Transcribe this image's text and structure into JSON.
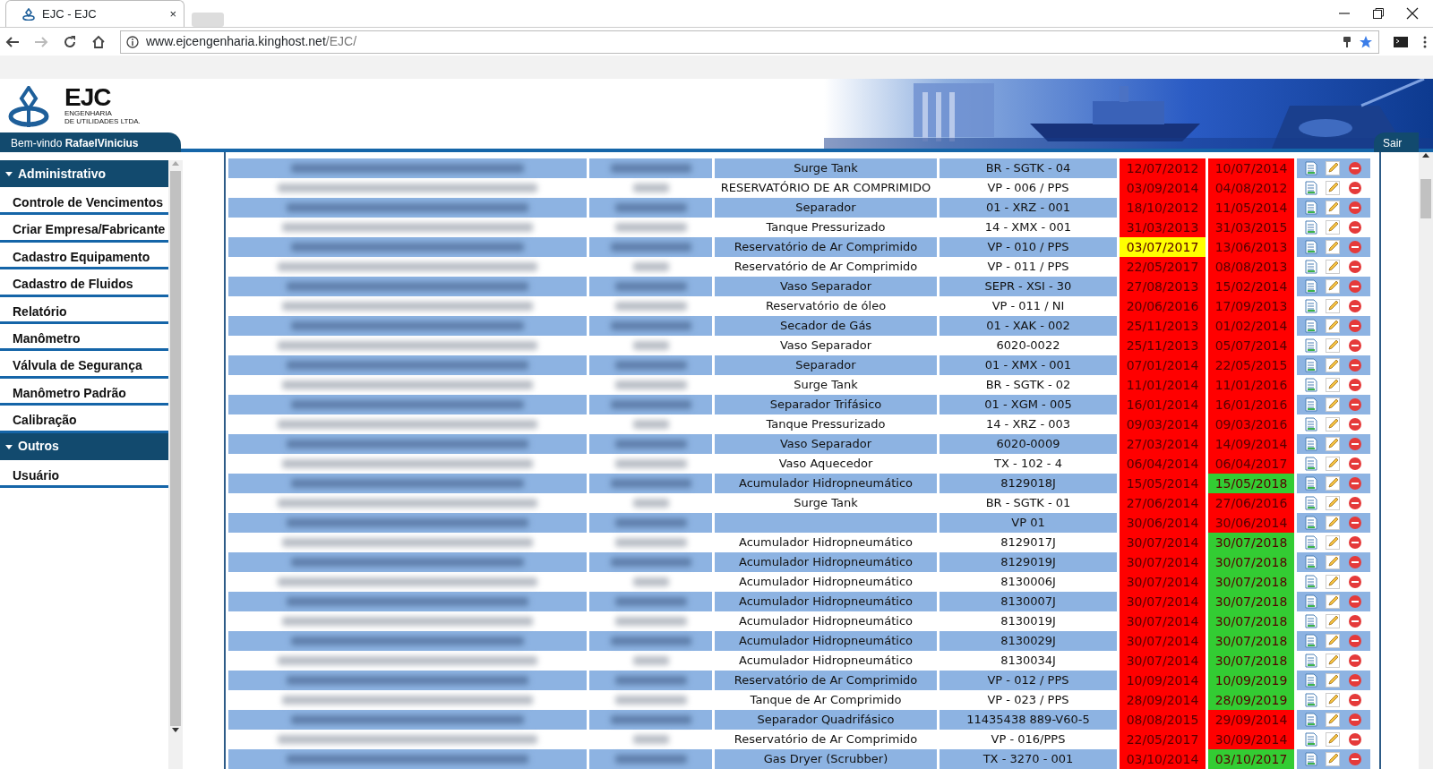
{
  "browser": {
    "tab_title": "EJC - EJC",
    "tab_close": "×",
    "url_host": "www.ejcengenharia.kinghost.net",
    "url_path": "/EJC/"
  },
  "header": {
    "logo_text": "EJC",
    "logo_subtitle_1": "ENGENHARIA",
    "logo_subtitle_2": "DE UTILIDADES LTDA.",
    "welcome": "Bem-vindo **RafaelVinicius**",
    "logout": "Sair"
  },
  "sidebar": {
    "sections": [
      {
        "label": "Administrativo",
        "expanded": true,
        "items": [
          "Controle de Vencimentos",
          "Criar Empresa/Fabricante",
          "Cadastro Equipamento",
          "Cadastro de Fluidos",
          "Relatório",
          "Manômetro",
          "Válvula de Segurança",
          "Manômetro Padrão",
          "Calibração"
        ]
      },
      {
        "label": "Outros",
        "expanded": true,
        "items": [
          "Usuário"
        ]
      }
    ]
  },
  "table": {
    "rows": [
      {
        "equipment": "Surge Tank",
        "tag": "BR - SGTK - 04",
        "date_1": {
          "text": "12/07/2012",
          "color": "#ff0000"
        },
        "date_2": {
          "text": "10/07/2014",
          "color": "#ff0000"
        }
      },
      {
        "equipment": "RESERVATÓRIO DE AR COMPRIMIDO",
        "tag": "VP - 006 / PPS",
        "date_1": {
          "text": "03/09/2014",
          "color": "#ff0000"
        },
        "date_2": {
          "text": "04/08/2012",
          "color": "#ff0000"
        }
      },
      {
        "equipment": "Separador",
        "tag": "01 - XRZ - 001",
        "date_1": {
          "text": "18/10/2012",
          "color": "#ff0000"
        },
        "date_2": {
          "text": "11/05/2014",
          "color": "#ff0000"
        }
      },
      {
        "equipment": "Tanque Pressurizado",
        "tag": "14 - XMX - 001",
        "date_1": {
          "text": "31/03/2013",
          "color": "#ff0000"
        },
        "date_2": {
          "text": "31/03/2015",
          "color": "#ff0000"
        }
      },
      {
        "equipment": "Reservatório de Ar Comprimido",
        "tag": "VP - 010 / PPS",
        "date_1": {
          "text": "03/07/2017",
          "color": "#ffff00"
        },
        "date_2": {
          "text": "13/06/2013",
          "color": "#ff0000"
        }
      },
      {
        "equipment": "Reservatório de Ar Comprimido",
        "tag": "VP - 011 / PPS",
        "date_1": {
          "text": "22/05/2017",
          "color": "#ff0000"
        },
        "date_2": {
          "text": "08/08/2013",
          "color": "#ff0000"
        }
      },
      {
        "equipment": "Vaso Separador",
        "tag": "SEPR - XSI - 30",
        "date_1": {
          "text": "27/08/2013",
          "color": "#ff0000"
        },
        "date_2": {
          "text": "15/02/2014",
          "color": "#ff0000"
        }
      },
      {
        "equipment": "Reservatório de óleo",
        "tag": "VP - 011 / NI",
        "date_1": {
          "text": "20/06/2016",
          "color": "#ff0000"
        },
        "date_2": {
          "text": "17/09/2013",
          "color": "#ff0000"
        }
      },
      {
        "equipment": "Secador de Gás",
        "tag": "01 - XAK - 002",
        "date_1": {
          "text": "25/11/2013",
          "color": "#ff0000"
        },
        "date_2": {
          "text": "01/02/2014",
          "color": "#ff0000"
        }
      },
      {
        "equipment": "Vaso Separador",
        "tag": "6020-0022",
        "date_1": {
          "text": "25/11/2013",
          "color": "#ff0000"
        },
        "date_2": {
          "text": "05/07/2014",
          "color": "#ff0000"
        }
      },
      {
        "equipment": "Separador",
        "tag": "01 - XMX - 001",
        "date_1": {
          "text": "07/01/2014",
          "color": "#ff0000"
        },
        "date_2": {
          "text": "22/05/2015",
          "color": "#ff0000"
        }
      },
      {
        "equipment": "Surge Tank",
        "tag": "BR - SGTK - 02",
        "date_1": {
          "text": "11/01/2014",
          "color": "#ff0000"
        },
        "date_2": {
          "text": "11/01/2016",
          "color": "#ff0000"
        }
      },
      {
        "equipment": "Separador Trifásico",
        "tag": "01 - XGM - 005",
        "date_1": {
          "text": "16/01/2014",
          "color": "#ff0000"
        },
        "date_2": {
          "text": "16/01/2016",
          "color": "#ff0000"
        }
      },
      {
        "equipment": "Tanque Pressurizado",
        "tag": "14 - XRZ - 003",
        "date_1": {
          "text": "09/03/2014",
          "color": "#ff0000"
        },
        "date_2": {
          "text": "09/03/2016",
          "color": "#ff0000"
        }
      },
      {
        "equipment": "Vaso Separador",
        "tag": "6020-0009",
        "date_1": {
          "text": "27/03/2014",
          "color": "#ff0000"
        },
        "date_2": {
          "text": "14/09/2014",
          "color": "#ff0000"
        }
      },
      {
        "equipment": "Vaso Aquecedor",
        "tag": "TX - 102 - 4",
        "date_1": {
          "text": "06/04/2014",
          "color": "#ff0000"
        },
        "date_2": {
          "text": "06/04/2017",
          "color": "#ff0000"
        }
      },
      {
        "equipment": "Acumulador Hidropneumático",
        "tag": "8129018J",
        "date_1": {
          "text": "15/05/2014",
          "color": "#ff0000"
        },
        "date_2": {
          "text": "15/05/2018",
          "color": "#33cc33"
        }
      },
      {
        "equipment": "Surge Tank",
        "tag": "BR - SGTK - 01",
        "date_1": {
          "text": "27/06/2014",
          "color": "#ff0000"
        },
        "date_2": {
          "text": "27/06/2016",
          "color": "#ff0000"
        }
      },
      {
        "tag": "VP 01",
        "date_1": {
          "text": "30/06/2014",
          "color": "#ff0000"
        },
        "date_2": {
          "text": "30/06/2014",
          "color": "#ff0000"
        }
      },
      {
        "equipment": "Acumulador Hidropneumático",
        "tag": "8129017J",
        "date_1": {
          "text": "30/07/2014",
          "color": "#ff0000"
        },
        "date_2": {
          "text": "30/07/2018",
          "color": "#33cc33"
        }
      },
      {
        "equipment": "Acumulador Hidropneumático",
        "tag": "8129019J",
        "date_1": {
          "text": "30/07/2014",
          "color": "#ff0000"
        },
        "date_2": {
          "text": "30/07/2018",
          "color": "#33cc33"
        }
      },
      {
        "equipment": "Acumulador Hidropneumático",
        "tag": "8130006J",
        "date_1": {
          "text": "30/07/2014",
          "color": "#ff0000"
        },
        "date_2": {
          "text": "30/07/2018",
          "color": "#33cc33"
        }
      },
      {
        "equipment": "Acumulador Hidropneumático",
        "tag": "8130007J",
        "date_1": {
          "text": "30/07/2014",
          "color": "#ff0000"
        },
        "date_2": {
          "text": "30/07/2018",
          "color": "#33cc33"
        }
      },
      {
        "equipment": "Acumulador Hidropneumático",
        "tag": "8130019J",
        "date_1": {
          "text": "30/07/2014",
          "color": "#ff0000"
        },
        "date_2": {
          "text": "30/07/2018",
          "color": "#33cc33"
        }
      },
      {
        "equipment": "Acumulador Hidropneumático",
        "tag": "8130029J",
        "date_1": {
          "text": "30/07/2014",
          "color": "#ff0000"
        },
        "date_2": {
          "text": "30/07/2018",
          "color": "#33cc33"
        }
      },
      {
        "equipment": "Acumulador Hidropneumático",
        "tag": "8130034J",
        "date_1": {
          "text": "30/07/2014",
          "color": "#ff0000"
        },
        "date_2": {
          "text": "30/07/2018",
          "color": "#33cc33"
        }
      },
      {
        "equipment": "Reservatório de Ar Comprimido",
        "tag": "VP - 012 / PPS",
        "date_1": {
          "text": "10/09/2014",
          "color": "#ff0000"
        },
        "date_2": {
          "text": "10/09/2019",
          "color": "#33cc33"
        }
      },
      {
        "equipment": "Tanque de Ar Comprimido",
        "tag": "VP - 023 / PPS",
        "date_1": {
          "text": "28/09/2014",
          "color": "#ff0000"
        },
        "date_2": {
          "text": "28/09/2019",
          "color": "#33cc33"
        }
      },
      {
        "equipment": "Separador Quadrifásico",
        "tag": "11435438 889-V60-5",
        "date_1": {
          "text": "08/08/2015",
          "color": "#ff0000"
        },
        "date_2": {
          "text": "29/09/2014",
          "color": "#ff0000"
        }
      },
      {
        "equipment": "Reservatório de Ar Comprimido",
        "tag": "VP - 016/PPS",
        "date_1": {
          "text": "22/05/2017",
          "color": "#ff0000"
        },
        "date_2": {
          "text": "30/09/2014",
          "color": "#ff0000"
        }
      },
      {
        "equipment": "Gas Dryer (Scrubber)",
        "tag": "TX - 3270 - 001",
        "date_1": {
          "text": "03/10/2014",
          "color": "#ff0000"
        },
        "date_2": {
          "text": "03/10/2017",
          "color": "#33cc33"
        }
      }
    ]
  }
}
